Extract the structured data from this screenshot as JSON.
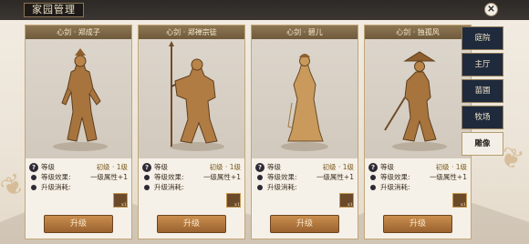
{
  "window": {
    "title": "家园管理"
  },
  "tabs": [
    {
      "label": "庭院",
      "active": false
    },
    {
      "label": "主厅",
      "active": false
    },
    {
      "label": "苗圃",
      "active": false
    },
    {
      "label": "牧场",
      "active": false
    },
    {
      "label": "雕像",
      "active": true
    }
  ],
  "stat_labels": {
    "level": "等级",
    "effect": "等级效果:",
    "cost": "升级消耗:"
  },
  "cards": [
    {
      "name": "心剑 · 郑成子",
      "level": "初级 · 1级",
      "effect": "一级属性+1",
      "material_count": "x1",
      "upgrade_label": "升级"
    },
    {
      "name": "心剑 · 郑禅宗徒",
      "level": "初级 · 1级",
      "effect": "一级属性+1",
      "material_count": "x1",
      "upgrade_label": "升级"
    },
    {
      "name": "心剑 · 碧儿",
      "level": "初级 · 1级",
      "effect": "一级属性+1",
      "material_count": "x1",
      "upgrade_label": "升级"
    },
    {
      "name": "心剑 · 独孤风",
      "level": "初级 · 1级",
      "effect": "一级属性+1",
      "material_count": "x1",
      "upgrade_label": "升级"
    }
  ],
  "colors": {
    "accent": "#9a6230",
    "tab_bg": "#1f2a3d",
    "gold": "#c59a55"
  }
}
